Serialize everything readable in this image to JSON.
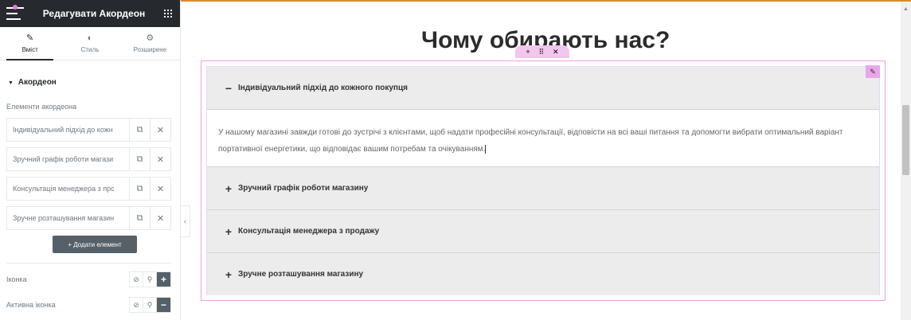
{
  "panel": {
    "title": "Редагувати Акордеон",
    "tabs": [
      {
        "label": "Вміст",
        "icon": "pencil-icon"
      },
      {
        "label": "Стиль",
        "icon": "contrast-icon"
      },
      {
        "label": "Розширене",
        "icon": "gear-icon"
      }
    ],
    "section_title": "Акордеон",
    "repeater_label": "Елементи акордеона",
    "items": [
      {
        "label": "Індивідуальний підхід до кожн"
      },
      {
        "label": "Зручний графік роботи магази"
      },
      {
        "label": "Консультація менеджера з прс"
      },
      {
        "label": "Зручне розташування магазин"
      }
    ],
    "add_button": "+ Додати елемент",
    "controls": [
      {
        "label": "Іконка",
        "active_symbol": "+"
      },
      {
        "label": "Активна іконка",
        "active_symbol": "−"
      }
    ]
  },
  "canvas": {
    "heading": "Чому обирають нас?",
    "accordion": [
      {
        "title": "Індивідуальний підхід до кожного покупця",
        "sign": "−",
        "open": true,
        "content": "У нашому магазині завжди готові до зустрічі з клієнтами, щоб надати професійні консультації, відповісти на всі ваші питання та допомогти вибрати оптимальний варіант портативної енергетики, що відповідає вашим потребам та очікуванням."
      },
      {
        "title": "Зручний графік роботи магазину",
        "sign": "+",
        "open": false
      },
      {
        "title": "Консультація менеджера з продажу",
        "sign": "+",
        "open": false
      },
      {
        "title": "Зручне розташування магазину",
        "sign": "+",
        "open": false
      }
    ]
  },
  "colors": {
    "panel_header": "#26292d",
    "accent_pink": "#e8a3e0",
    "accordion_title_bg": "#ececec"
  }
}
